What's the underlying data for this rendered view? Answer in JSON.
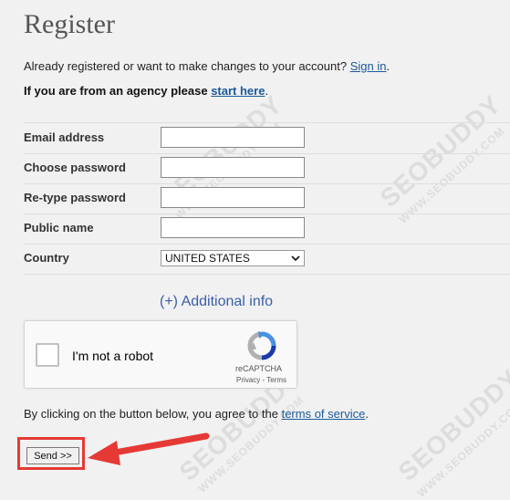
{
  "page": {
    "title": "Register",
    "already_registered_text": "Already registered or want to make changes to your account? ",
    "sign_in_link": "Sign in",
    "period": ".",
    "agency_text": "If you are from an agency please ",
    "start_here_link": "start here"
  },
  "form": {
    "fields": [
      {
        "label": "Email address",
        "value": ""
      },
      {
        "label": "Choose password",
        "value": ""
      },
      {
        "label": "Re-type password",
        "value": ""
      },
      {
        "label": "Public name",
        "value": ""
      }
    ],
    "country_label": "Country",
    "country_value": "UNITED STATES",
    "additional_info": "(+) Additional info"
  },
  "captcha": {
    "label": "I'm not a robot",
    "brand": "reCAPTCHA",
    "privacy": "Privacy",
    "separator": " - ",
    "terms": "Terms"
  },
  "agreement": {
    "text": "By clicking on the button below, you agree to the ",
    "terms_link": "terms of service",
    "period": "."
  },
  "submit": {
    "label": "Send >>"
  },
  "watermark": {
    "text": "SEOBUDDY",
    "url": "WWW.SEOBUDDY.COM"
  },
  "colors": {
    "highlight": "#e53935",
    "link": "#1a5a9a"
  }
}
